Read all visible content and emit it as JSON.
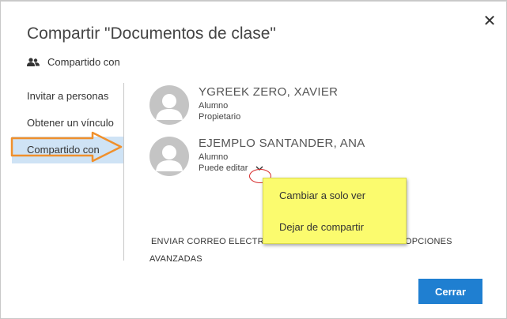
{
  "dialog": {
    "title": "Compartir \"Documentos de clase\"",
    "close_icon": "close-icon",
    "section_icon": "people-icon",
    "section_label": "Compartido con"
  },
  "sidebar": {
    "items": [
      {
        "label": "Invitar a personas"
      },
      {
        "label": "Obtener un vínculo"
      },
      {
        "label": "Compartido con",
        "active": true
      }
    ]
  },
  "people": [
    {
      "name": "YGREEK ZERO, XAVIER",
      "role": "Alumno",
      "permission": "Propietario"
    },
    {
      "name": "EJEMPLO SANTANDER, ANA",
      "role": "Alumno",
      "permission": "Puede editar",
      "has_dropdown": true
    }
  ],
  "dropdown_menu": {
    "items": [
      {
        "label": "Cambiar a solo ver"
      },
      {
        "label": "Dejar de compartir"
      }
    ]
  },
  "advanced": {
    "left_text": "ENVIAR CORREO ELECTRÓ",
    "right_text": "OPCIONES",
    "second_line": "AVANZADAS"
  },
  "footer": {
    "close_label": "Cerrar"
  },
  "colors": {
    "accent": "#1f7fd1",
    "sidebar_active": "#cfe3f5",
    "menu_highlight": "#fbfb6e",
    "annotation_arrow": "#f0902c",
    "annotation_ring": "#d62a2a"
  }
}
